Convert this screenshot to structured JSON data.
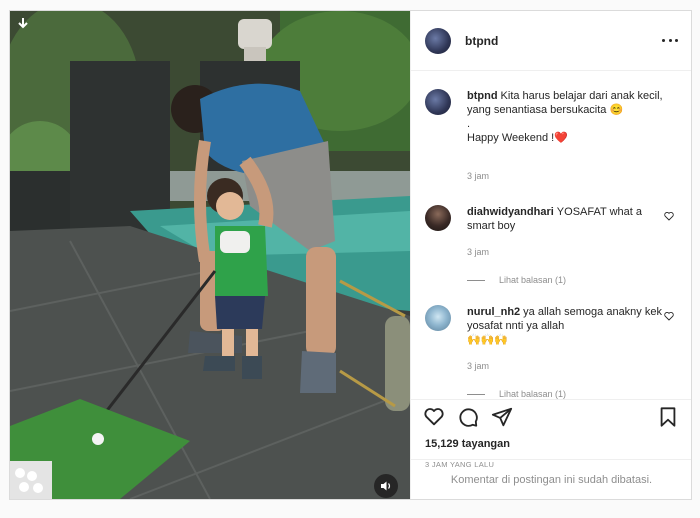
{
  "post": {
    "username": "btpnd",
    "caption": "Kita harus belajar dari anak kecil, yang senantiasa bersukacita 😊",
    "caption_dot": ".",
    "caption_line2": "Happy Weekend !❤️",
    "caption_time": "3 jam",
    "views": "15,129 tayangan",
    "posted_ago": "3 JAM YANG LALU",
    "comments_closed": "Komentar di postingan ini sudah dibatasi."
  },
  "comments": [
    {
      "username": "diahwidyandhari",
      "text": "YOSAFAT what a smart boy",
      "time": "3 jam",
      "replies": "Lihat balasan (1)"
    },
    {
      "username": "nurul_nh2",
      "text": "ya allah semoga anakny kek yosafat nnti ya allah",
      "emoji": "🙌🙌🙌",
      "time": "3 jam",
      "replies": "Lihat balasan (1)"
    }
  ],
  "icons": {
    "like": "heart-icon",
    "comment": "comment-icon",
    "share": "share-icon",
    "save": "bookmark-icon",
    "more": "more-icon",
    "audio": "speaker-icon",
    "download": "download-icon"
  },
  "colors": {
    "text": "#262626",
    "muted": "#8e8e8e",
    "border": "#dbdbdb",
    "heart": "#ed4956"
  }
}
